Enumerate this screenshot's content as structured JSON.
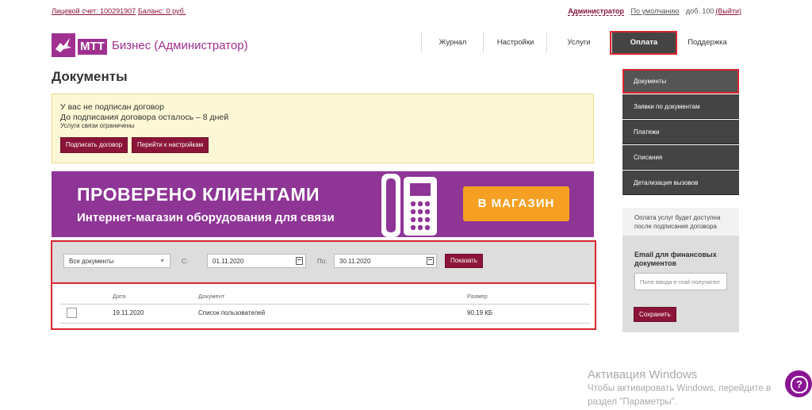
{
  "top": {
    "account_link": "Лицевой счет: 100291907",
    "balance_link": "Баланс: 0 руб.",
    "admin": "Администратор",
    "default": "По умолчанию",
    "ext": "доб. 100",
    "logout": "(Выйти)"
  },
  "logo": {
    "mtt": "МТТ",
    "title": "Бизнес (Администратор)"
  },
  "nav": {
    "journal": "Журнал",
    "settings": "Настройки",
    "services": "Услуги",
    "payment": "Оплата",
    "support": "Поддержка"
  },
  "page_title": "Документы",
  "alert": {
    "line1": "У вас не подписан договор",
    "line2": "До подписания договора осталось – 8 дней",
    "line3": "Услуги связи ограничены",
    "sign_button": "Подписать договор",
    "settings_button": "Перейти к настройкам"
  },
  "banner": {
    "headline": "ПРОВЕРЕНО КЛИЕНТАМИ",
    "sub": "Интернет-магазин оборудования для связи",
    "shop_button": "В МАГАЗИН",
    "bg_color": "#8e3596",
    "button_color": "#f5a023"
  },
  "filter": {
    "doc_type": "Все документы",
    "from_label": "С:",
    "from_value": "01.11.2020",
    "to_label": "По:",
    "to_value": "30.11.2020",
    "show_button": "Показать"
  },
  "table": {
    "columns": [
      "Дата",
      "Документ",
      "Размер"
    ],
    "rows": [
      {
        "date": "19.11.2020",
        "document": "Список пользователей",
        "size": "90,19 КБ"
      }
    ]
  },
  "sidebar": {
    "items": [
      "Документы",
      "Заявки по документам",
      "Платежи",
      "Списания",
      "Детализация вызовов"
    ],
    "note": "Оплата услуг будет доступна после подписания договора",
    "email_heading": "Email для финансовых документов",
    "email_placeholder": "Поле ввода e-mail получател",
    "save_button": "Сохранить"
  },
  "windows": {
    "title": "Активация Windows",
    "line1": "Чтобы активировать Windows, перейдите в",
    "line2": "раздел \"Параметры\"."
  },
  "colors": {
    "accent": "#8b1538",
    "brand": "#a03090",
    "highlight": "#d7262f"
  }
}
